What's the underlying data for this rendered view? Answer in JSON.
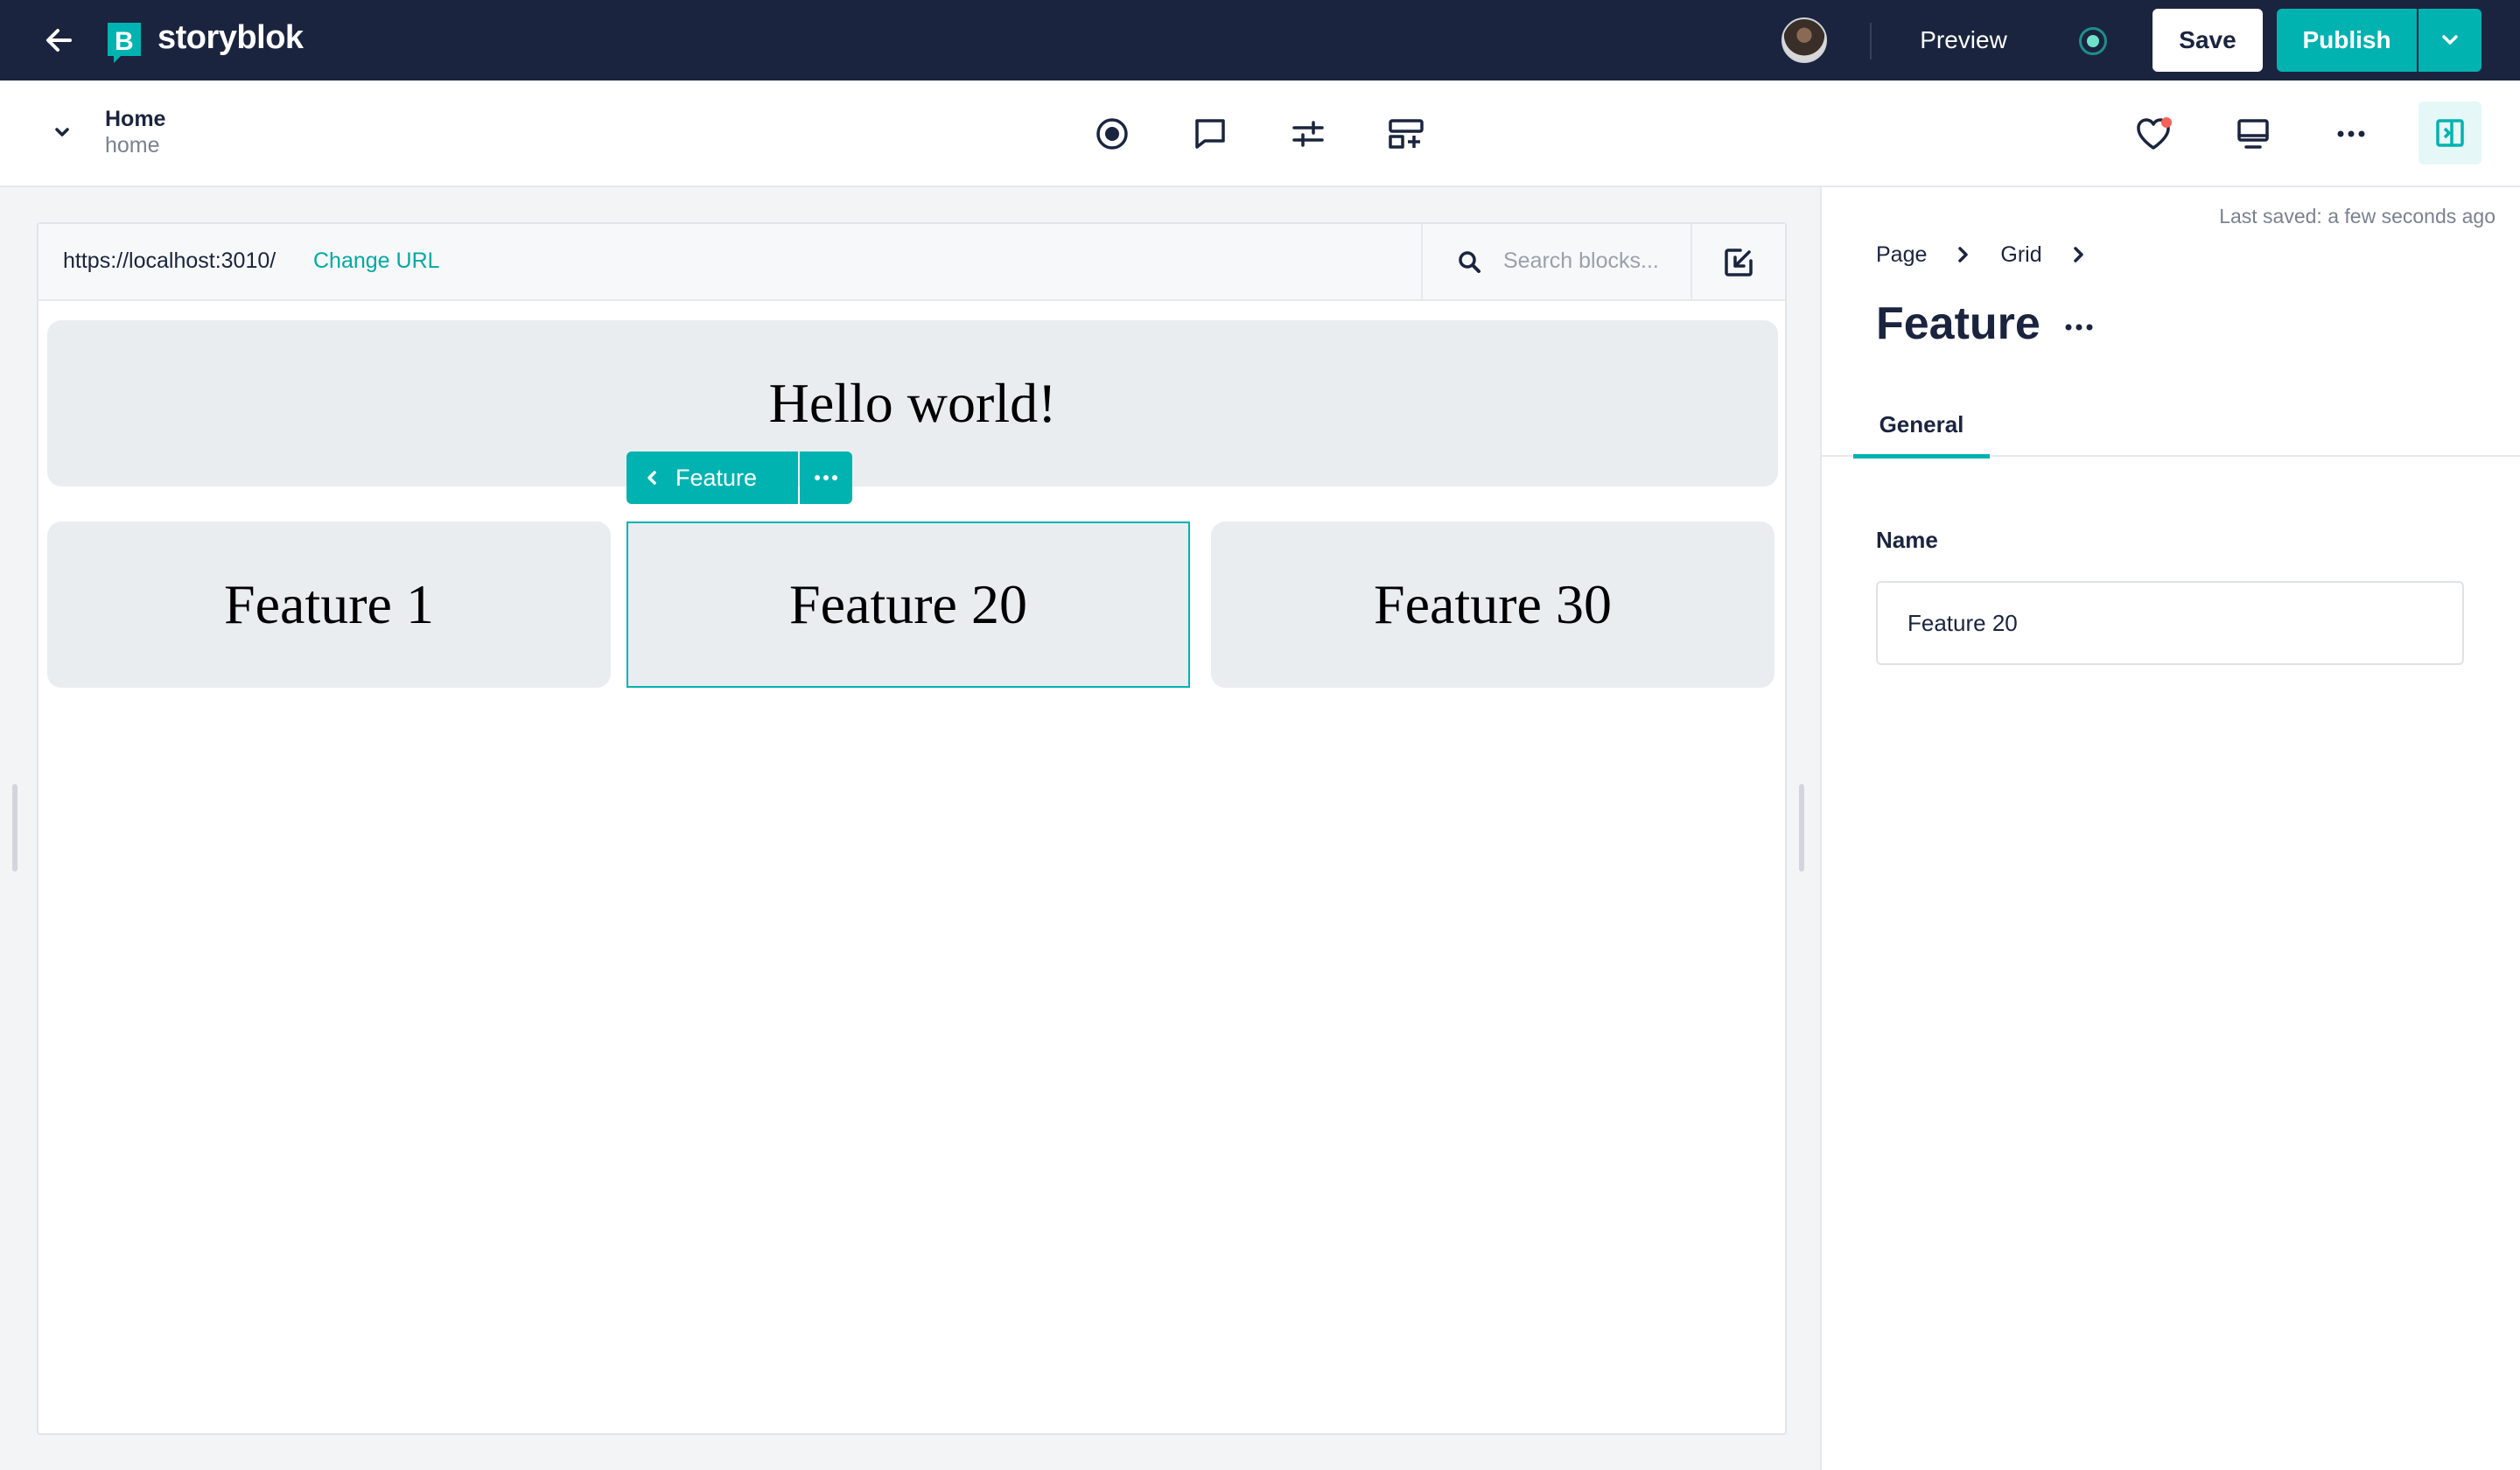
{
  "app": {
    "logo_text": "storyblok",
    "colors": {
      "topbar": "#1b243f",
      "accent": "#00b3b0",
      "canvas_bg": "#eaedf0"
    }
  },
  "topbar": {
    "preview_label": "Preview",
    "save_label": "Save",
    "publish_label": "Publish"
  },
  "story": {
    "name": "Home",
    "slug": "home"
  },
  "toolbar_icons": [
    "visual-editor-icon",
    "comments-icon",
    "settings-sliders-icon",
    "add-block-icon"
  ],
  "right_icons": [
    "favorite-heart-icon",
    "desktop-preview-icon",
    "more-icon",
    "side-panel-icon"
  ],
  "urlbar": {
    "url": "https://localhost:3010/",
    "change_url_label": "Change URL",
    "search_placeholder": "Search blocks..."
  },
  "canvas": {
    "hero_title": "Hello world!",
    "block_tag_label": "Feature",
    "features": [
      "Feature 1",
      "Feature 20",
      "Feature 30"
    ],
    "selected_feature": "Feature 20"
  },
  "panel": {
    "last_saved": "Last saved: a few seconds ago",
    "breadcrumbs": [
      "Page",
      "Grid"
    ],
    "title": "Feature",
    "tabs": [
      "General"
    ],
    "name_label": "Name",
    "name_value": "Feature 20"
  }
}
